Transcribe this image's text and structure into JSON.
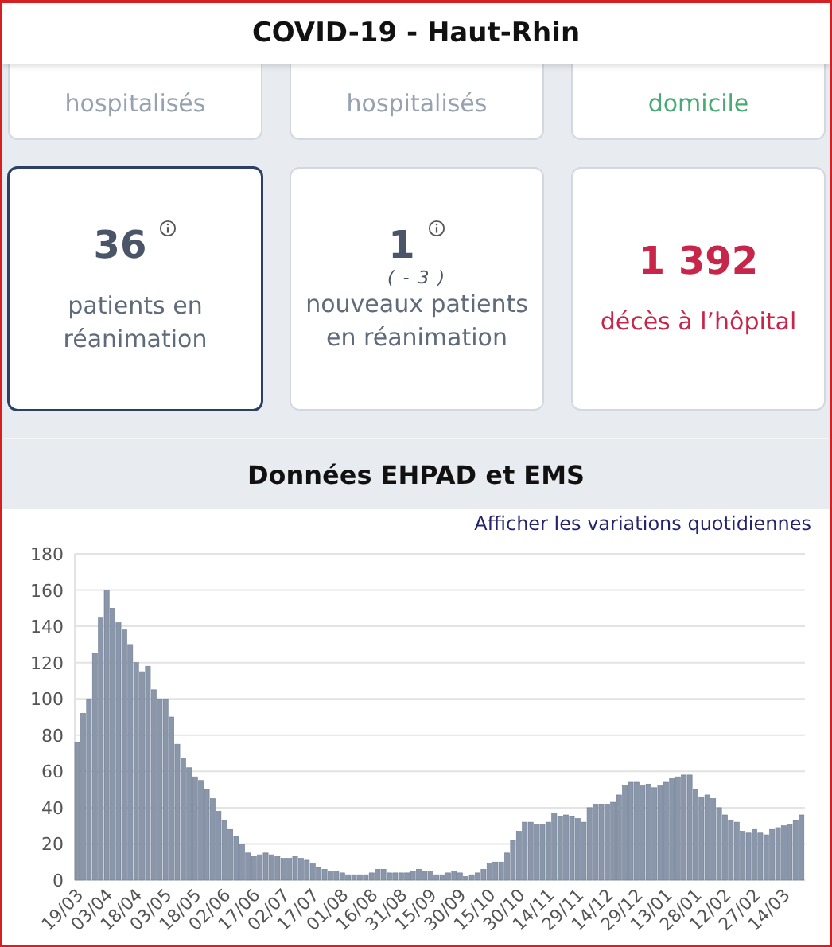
{
  "header": {
    "title": "COVID-19 - Haut-Rhin"
  },
  "top_cards": [
    {
      "kind": "neutral",
      "label": "hospitalisés"
    },
    {
      "kind": "neutral",
      "label": "hospitalisés"
    },
    {
      "kind": "positive",
      "label": "domicile"
    }
  ],
  "cards": [
    {
      "kind": "neutral",
      "selected": true,
      "value": "36",
      "info": true,
      "label": "patients en réanimation"
    },
    {
      "kind": "neutral",
      "selected": false,
      "value": "1",
      "info": true,
      "variation": "( - 3 )",
      "label": "nouveaux patients en réanimation"
    },
    {
      "kind": "negative",
      "selected": false,
      "value": "1 392",
      "info": false,
      "label": "décès à l’hôpital"
    }
  ],
  "section": {
    "title": "Données EHPAD et EMS",
    "link": "Afficher les variations quotidiennes",
    "chart_data": {
      "type": "bar",
      "grid": true,
      "ylim": [
        0,
        180
      ],
      "yticks": [
        0,
        20,
        40,
        60,
        80,
        100,
        120,
        140,
        160,
        180
      ],
      "categories": [
        "19/03",
        null,
        null,
        null,
        null,
        "03/04",
        null,
        null,
        null,
        null,
        "18/04",
        null,
        null,
        null,
        null,
        "03/05",
        null,
        null,
        null,
        null,
        "18/05",
        null,
        null,
        null,
        null,
        "02/06",
        null,
        null,
        null,
        null,
        "17/06",
        null,
        null,
        null,
        null,
        "02/07",
        null,
        null,
        null,
        null,
        "17/07",
        null,
        null,
        null,
        null,
        "01/08",
        null,
        null,
        null,
        null,
        "16/08",
        null,
        null,
        null,
        null,
        "31/08",
        null,
        null,
        null,
        null,
        "15/09",
        null,
        null,
        null,
        null,
        "30/09",
        null,
        null,
        null,
        null,
        "15/10",
        null,
        null,
        null,
        null,
        "30/10",
        null,
        null,
        null,
        null,
        "14/11",
        null,
        null,
        null,
        null,
        "29/11",
        null,
        null,
        null,
        null,
        "14/12",
        null,
        null,
        null,
        null,
        "29/12",
        null,
        null,
        null,
        null,
        "13/01",
        null,
        null,
        null,
        null,
        "28/01",
        null,
        null,
        null,
        null,
        "12/02",
        null,
        null,
        null,
        null,
        "27/02",
        null,
        null,
        null,
        null,
        "14/03",
        null,
        null,
        null
      ],
      "series": [
        {
          "color": "#8a96aa",
          "values": [
            76,
            92,
            100,
            125,
            145,
            160,
            150,
            142,
            138,
            130,
            120,
            115,
            118,
            105,
            100,
            100,
            90,
            75,
            67,
            62,
            57,
            55,
            50,
            45,
            38,
            33,
            28,
            24,
            20,
            15,
            13,
            14,
            15,
            14,
            13,
            12,
            12,
            13,
            12,
            11,
            9,
            7,
            6,
            5,
            5,
            4,
            3,
            3,
            3,
            3,
            4,
            6,
            6,
            4,
            4,
            4,
            4,
            5,
            6,
            5,
            5,
            3,
            3,
            4,
            5,
            4,
            2,
            3,
            4,
            6,
            9,
            10,
            10,
            15,
            22,
            27,
            32,
            32,
            31,
            31,
            32,
            37,
            35,
            36,
            35,
            34,
            32,
            40,
            42,
            42,
            42,
            43,
            47,
            52,
            54,
            54,
            52,
            53,
            51,
            52,
            54,
            56,
            57,
            58,
            58,
            50,
            46,
            47,
            45,
            40,
            36,
            33,
            32,
            27,
            26,
            28,
            26,
            25,
            28,
            29,
            30,
            31,
            33,
            36
          ]
        }
      ]
    }
  }
}
